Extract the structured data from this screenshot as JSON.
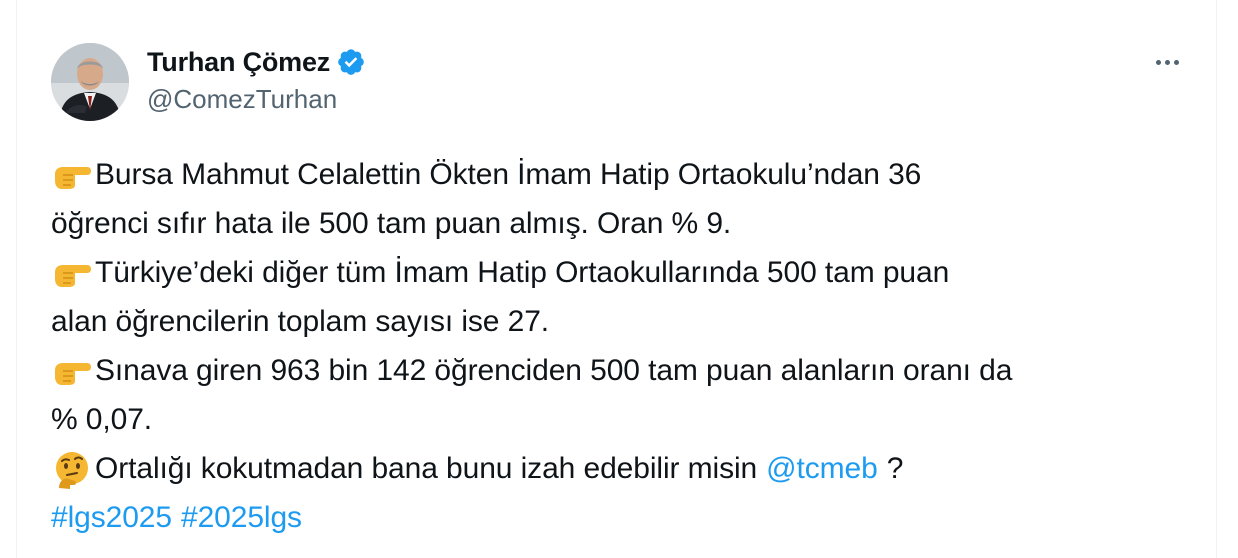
{
  "author": {
    "display_name": "Turhan Çömez",
    "handle": "@ComezTurhan",
    "verified": true,
    "avatar_icon": "profile-photo",
    "more_icon": "more-dots-icon"
  },
  "colors": {
    "text": "#0f1419",
    "secondary": "#536471",
    "link": "#1d9bf0",
    "verified": "#1d9bf0"
  },
  "tweet": {
    "lines": [
      {
        "emoji": "backhand-index-pointing-right",
        "text": "Bursa Mahmut Celalettin Ökten İmam Hatip Ortaokulu’ndan 36"
      },
      {
        "text": "öğrenci sıfır hata ile 500 tam puan almış. Oran % 9."
      },
      {
        "emoji": "backhand-index-pointing-right",
        "text": "Türkiye’deki diğer tüm İmam Hatip Ortaokullarında 500 tam puan"
      },
      {
        "text": "alan öğrencilerin toplam sayısı ise 27."
      },
      {
        "emoji": "backhand-index-pointing-right",
        "text": "Sınava giren 963 bin 142 öğrenciden 500 tam puan alanların oranı da"
      },
      {
        "text": "% 0,07."
      },
      {
        "emoji": "thinking-face",
        "text": "Ortalığı kokutmadan bana bunu izah edebilir misin",
        "mention": "@tcmeb",
        "suffix": "?"
      }
    ],
    "hashtags": [
      "#lgs2025",
      "#2025lgs"
    ]
  }
}
